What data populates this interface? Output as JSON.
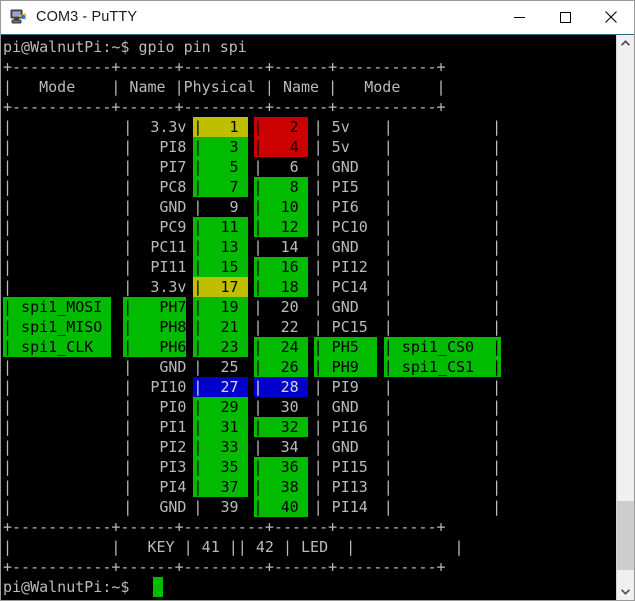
{
  "window": {
    "title": "COM3 - PuTTY",
    "icon": "putty-computer-icon",
    "minimize_label": "─",
    "maximize_label": "☐",
    "close_label": "✕"
  },
  "terminal": {
    "prompt_command_line": "pi@WalnutPi:~$ gpio pin spi",
    "prompt_last": "pi@WalnutPi:~$ ",
    "cursor": " ",
    "rule": "+-----------+------+---------+------+-----------+",
    "header": {
      "mode_left": "Mode",
      "name_left": "Name",
      "physical": "Physical",
      "name_right": "Name",
      "mode_right": "Mode"
    },
    "colors": {
      "background": "#000000",
      "foreground": "#bbbbbb",
      "green": "#00bb00",
      "red": "#cc0000",
      "yellow": "#bfbf00",
      "blue": "#0000cc"
    },
    "footer_row": {
      "name_left": "KEY",
      "pin_left": "41",
      "pin_right": "42",
      "name_right": "LED"
    },
    "rows": [
      {
        "mode_left": "",
        "name_left": "3.3v",
        "pin_left": "1",
        "pin_right": "2",
        "name_right": "5v",
        "mode_right": "",
        "color_left": "yellow",
        "color_right": "red"
      },
      {
        "mode_left": "",
        "name_left": "PI8",
        "pin_left": "3",
        "pin_right": "4",
        "name_right": "5v",
        "mode_right": "",
        "color_left": "green",
        "color_right": "red"
      },
      {
        "mode_left": "",
        "name_left": "PI7",
        "pin_left": "5",
        "pin_right": "6",
        "name_right": "GND",
        "mode_right": "",
        "color_left": "green",
        "color_right": "black"
      },
      {
        "mode_left": "",
        "name_left": "PC8",
        "pin_left": "7",
        "pin_right": "8",
        "name_right": "PI5",
        "mode_right": "",
        "color_left": "green",
        "color_right": "green"
      },
      {
        "mode_left": "",
        "name_left": "GND",
        "pin_left": "9",
        "pin_right": "10",
        "name_right": "PI6",
        "mode_right": "",
        "color_left": "black",
        "color_right": "green"
      },
      {
        "mode_left": "",
        "name_left": "PC9",
        "pin_left": "11",
        "pin_right": "12",
        "name_right": "PC10",
        "mode_right": "",
        "color_left": "green",
        "color_right": "green"
      },
      {
        "mode_left": "",
        "name_left": "PC11",
        "pin_left": "13",
        "pin_right": "14",
        "name_right": "GND",
        "mode_right": "",
        "color_left": "green",
        "color_right": "black"
      },
      {
        "mode_left": "",
        "name_left": "PI11",
        "pin_left": "15",
        "pin_right": "16",
        "name_right": "PI12",
        "mode_right": "",
        "color_left": "green",
        "color_right": "green"
      },
      {
        "mode_left": "",
        "name_left": "3.3v",
        "pin_left": "17",
        "pin_right": "18",
        "name_right": "PC14",
        "mode_right": "",
        "color_left": "yellow",
        "color_right": "green"
      },
      {
        "mode_left": "spi1_MOSI",
        "name_left": "PH7",
        "pin_left": "19",
        "pin_right": "20",
        "name_right": "GND",
        "mode_right": "",
        "color_left": "green",
        "color_right": "black",
        "row_green_left": true
      },
      {
        "mode_left": "spi1_MISO",
        "name_left": "PH8",
        "pin_left": "21",
        "pin_right": "22",
        "name_right": "PC15",
        "mode_right": "",
        "color_left": "green",
        "color_right": "black",
        "row_green_left": true
      },
      {
        "mode_left": "spi1_CLK",
        "name_left": "PH6",
        "pin_left": "23",
        "pin_right": "24",
        "name_right": "PH5",
        "mode_right": "spi1_CS0",
        "color_left": "green",
        "color_right": "green",
        "row_green_left": true,
        "row_green_right": true
      },
      {
        "mode_left": "",
        "name_left": "GND",
        "pin_left": "25",
        "pin_right": "26",
        "name_right": "PH9",
        "mode_right": "spi1_CS1",
        "color_left": "black",
        "color_right": "green",
        "row_green_right": true
      },
      {
        "mode_left": "",
        "name_left": "PI10",
        "pin_left": "27",
        "pin_right": "28",
        "name_right": "PI9",
        "mode_right": "",
        "color_left": "blue",
        "color_right": "blue"
      },
      {
        "mode_left": "",
        "name_left": "PI0",
        "pin_left": "29",
        "pin_right": "30",
        "name_right": "GND",
        "mode_right": "",
        "color_left": "green",
        "color_right": "black"
      },
      {
        "mode_left": "",
        "name_left": "PI1",
        "pin_left": "31",
        "pin_right": "32",
        "name_right": "PI16",
        "mode_right": "",
        "color_left": "green",
        "color_right": "green"
      },
      {
        "mode_left": "",
        "name_left": "PI2",
        "pin_left": "33",
        "pin_right": "34",
        "name_right": "GND",
        "mode_right": "",
        "color_left": "green",
        "color_right": "black"
      },
      {
        "mode_left": "",
        "name_left": "PI3",
        "pin_left": "35",
        "pin_right": "36",
        "name_right": "PI15",
        "mode_right": "",
        "color_left": "green",
        "color_right": "green"
      },
      {
        "mode_left": "",
        "name_left": "PI4",
        "pin_left": "37",
        "pin_right": "38",
        "name_right": "PI13",
        "mode_right": "",
        "color_left": "green",
        "color_right": "green"
      },
      {
        "mode_left": "",
        "name_left": "GND",
        "pin_left": "39",
        "pin_right": "40",
        "name_right": "PI14",
        "mode_right": "",
        "color_left": "black",
        "color_right": "green"
      }
    ]
  },
  "scrollbar": {
    "up_arrow": "scroll-up-arrow",
    "down_arrow": "scroll-down-arrow"
  }
}
